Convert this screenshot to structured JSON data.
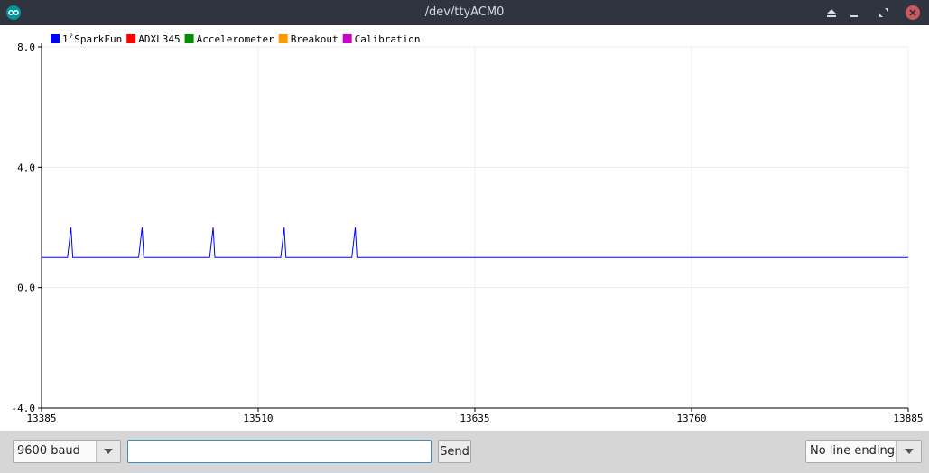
{
  "window": {
    "title": "/dev/ttyACM0",
    "icons": [
      "arduino-icon",
      "eject-icon",
      "minimize-icon",
      "maximize-icon",
      "close-icon"
    ]
  },
  "plot": {
    "legend": [
      {
        "label": "1ˀSparkFun",
        "color": "#0000ff"
      },
      {
        "label": "ADXL345",
        "color": "#ff0000"
      },
      {
        "label": "Accelerometer",
        "color": "#008f00"
      },
      {
        "label": "Breakout",
        "color": "#ff9900"
      },
      {
        "label": "Calibration",
        "color": "#cc00cc"
      }
    ]
  },
  "chart_data": {
    "type": "line",
    "title": "",
    "xlabel": "",
    "ylabel": "",
    "xlim": [
      13385,
      13885
    ],
    "ylim": [
      -4.0,
      8.0
    ],
    "x_ticks": [
      "13385",
      "13510",
      "13635",
      "13760",
      "13885"
    ],
    "y_ticks": [
      "8.0",
      "4.0",
      "0.0",
      "-4.0"
    ],
    "grid": true,
    "legend_position": "top-left",
    "series": [
      {
        "name": "1ˀSparkFun",
        "color": "#0000ff",
        "x": [
          13385,
          13400,
          13402,
          13403,
          13441,
          13443,
          13444,
          13482,
          13484,
          13485,
          13523,
          13525,
          13526,
          13564,
          13566,
          13567,
          13885
        ],
        "values": [
          1,
          1,
          2,
          1,
          1,
          2,
          1,
          1,
          2,
          1,
          1,
          2,
          1,
          1,
          2,
          1,
          1
        ]
      }
    ]
  },
  "toolbar": {
    "baud_value": "9600 baud",
    "input_value": "",
    "send_label": "Send",
    "line_ending_value": "No line ending"
  }
}
